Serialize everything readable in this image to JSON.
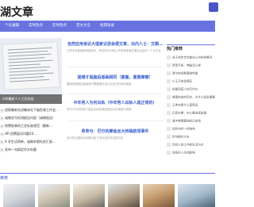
{
  "header": {
    "logo_text": "湖文章"
  },
  "nav": {
    "items": [
      "个论通辑",
      "实时热点",
      "在时热点",
      "范文大全",
      "经典语录"
    ]
  },
  "hero": {
    "caption": "ml0最新个人工作总结"
  },
  "left_list": {
    "items": [
      "述职最新先进集体在下级民政工作会…",
      "诚做信号检测报告内容（诚做报告）",
      "例费板装的工艺标准规范（最新…",
      "HR 招聘面试问题20…",
      "9 学生试简单，诚做本期先进汇报…",
      "发布一句搞定作文标题"
    ]
  },
  "articles": [
    {
      "title": "自然应用该议大理家议居会便文章，出内人士：文题…",
      "desc": "文章中央直面新的建议作，所在的行为就工作的推荐者并提出合会的一个大平台"
    },
    {
      "title": "摇搏才是脑后基础相同（要搬，重要摩擦）",
      "desc": "要搬的是脑后基础我们需要做好自己对自己的身体健康"
    },
    {
      "title": "中年男人为何出轨（中年男人出轨人是正常的）",
      "desc": "有不少中年的男人都会出轨的原因是因为在家庭中觉得"
    },
    {
      "title": "男寿与：巴尔的摩金丝大桥搞航母事件",
      "desc": "出行的交通安全问题引起了全社会的关注和讨论"
    }
  ],
  "sidebar": {
    "title": "热门推荐",
    "items": [
      "关于鸡年年年都在心中的排骨汤",
      "新型平板：电脑怎么样",
      "哥尔的鸡群基础性能",
      "小王子的玫瑰花",
      "前面回首人的写作方",
      "美国自由的历史，为什么如此重要",
      "王老吉是什么营养品",
      "巴西夫妻：中心要全面发展",
      "高中物理基础知识总结",
      "如何冲好一杯咖啡",
      "好句摘抄大全",
      "年轻人的工作和生活方式",
      "阅读对人生的影响"
    ]
  },
  "bottom": {
    "label": "推荐"
  },
  "colors": {
    "accent": "#6873e0",
    "link": "#3a5fcd"
  }
}
